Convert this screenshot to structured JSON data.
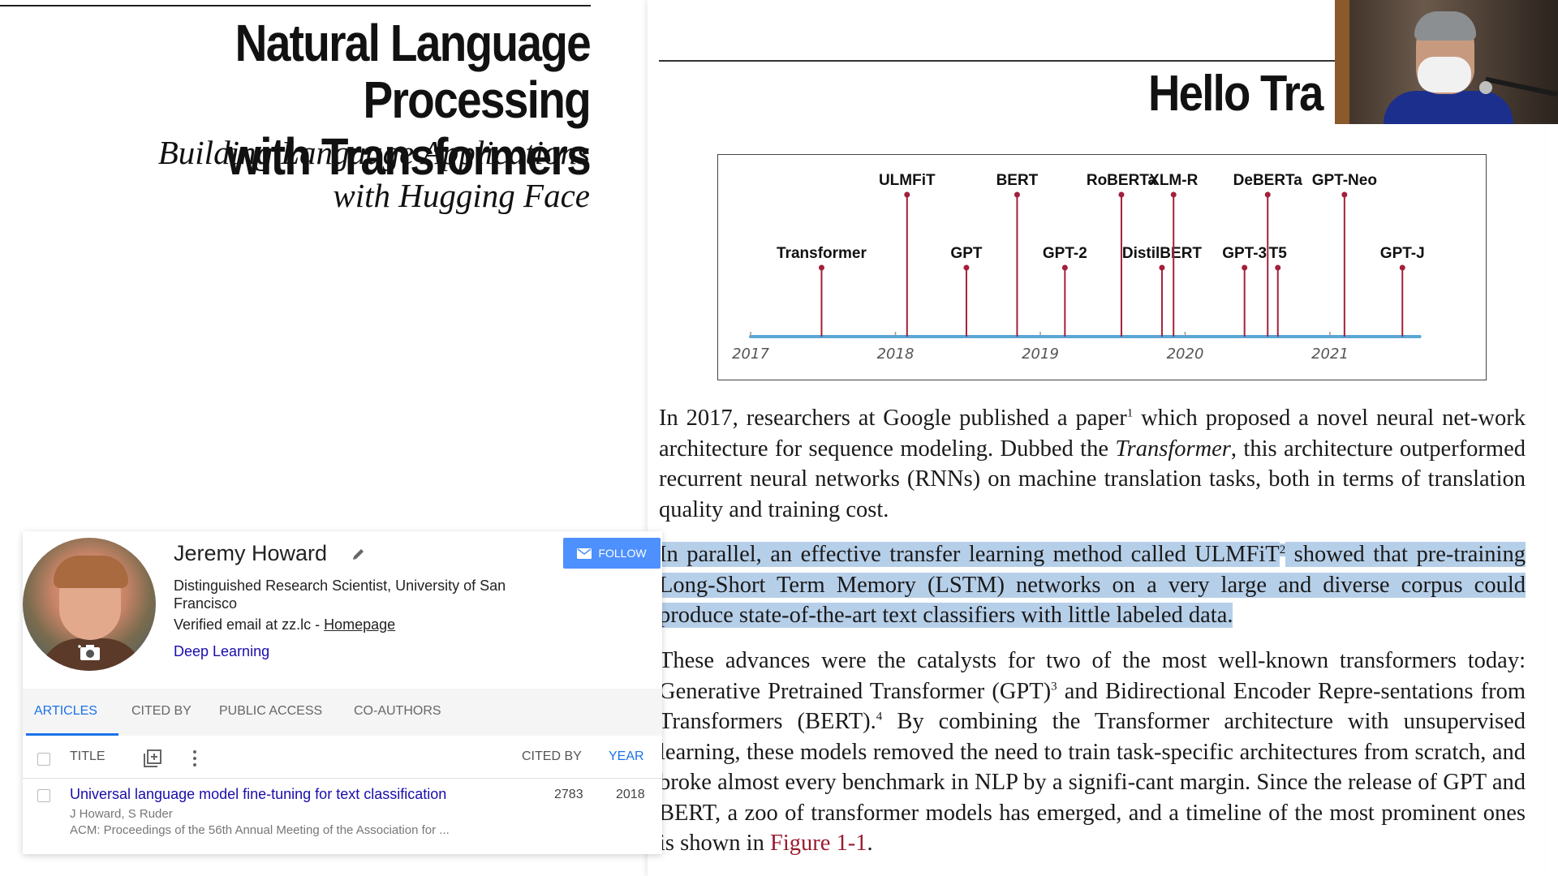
{
  "cover": {
    "title_line1": "Natural Language Processing",
    "title_line2": "with Transformers",
    "subtitle_line1": "Building Language Applications",
    "subtitle_line2": "with Hugging Face"
  },
  "page": {
    "heading": "Hello Tra",
    "paragraph1": {
      "before_sup": "In 2017, researchers at Google published a paper",
      "sup": "1",
      "after_sup": " which proposed a novel neural net-work architecture for sequence modeling. Dubbed the ",
      "italic": "Transformer",
      "end": ", this architecture outperformed recurrent neural networks (RNNs) on machine translation tasks, both in terms of translation quality and training cost."
    },
    "paragraph2": {
      "before_sup": "In parallel, an effective transfer learning method called ULMFiT",
      "sup": "2",
      "after_sup": " showed that pre-training Long-Short Term Memory (LSTM) networks on a very large and diverse corpus could produce state-of-the-art text classifiers with little labeled data."
    },
    "paragraph3": {
      "part1": "These advances were the catalysts for two of the most well-known transformers today: Generative Pretrained Transformer (GPT)",
      "sup1": "3",
      "part2": " and Bidirectional Encoder Repre-sentations from Transformers (BERT).",
      "sup2": "4",
      "part3": " By combining the Transformer architecture with unsupervised learning, these models removed the need to train task-specific architectures from scratch, and broke almost every benchmark in NLP by a signifi-cant margin. Since the release of GPT and BERT, a zoo of transformer models has emerged, and a timeline of the most prominent ones is shown in ",
      "figure_ref": "Figure 1-1",
      "end": "."
    }
  },
  "chart_data": {
    "type": "timeline",
    "x_ticks": [
      "2017",
      "2018",
      "2019",
      "2020",
      "2021"
    ],
    "xlim": [
      2017.0,
      2021.62
    ],
    "colors": {
      "axis": "#5aa6d6",
      "stem": "#a3203c"
    },
    "events": [
      {
        "label": "Transformer",
        "date": 2017.49,
        "level": "low"
      },
      {
        "label": "ULMFiT",
        "date": 2018.08,
        "level": "high"
      },
      {
        "label": "GPT",
        "date": 2018.49,
        "level": "low"
      },
      {
        "label": "BERT",
        "date": 2018.84,
        "level": "high"
      },
      {
        "label": "GPT-2",
        "date": 2019.17,
        "level": "low"
      },
      {
        "label": "RoBERTa",
        "date": 2019.56,
        "level": "high"
      },
      {
        "label": "DistilBERT",
        "date": 2019.84,
        "level": "low"
      },
      {
        "label": "XLM-R",
        "date": 2019.92,
        "level": "high"
      },
      {
        "label": "GPT-3",
        "date": 2020.41,
        "level": "low"
      },
      {
        "label": "DeBERTa",
        "date": 2020.57,
        "level": "high"
      },
      {
        "label": "T5",
        "date": 2020.64,
        "level": "low"
      },
      {
        "label": "GPT-Neo",
        "date": 2021.1,
        "level": "high"
      },
      {
        "label": "GPT-J",
        "date": 2021.5,
        "level": "low"
      }
    ]
  },
  "scholar": {
    "name": "Jeremy Howard",
    "affiliation": "Distinguished Research Scientist, University of San Francisco",
    "email_text": "Verified email at zz.lc - ",
    "homepage_label": "Homepage",
    "interest": "Deep Learning",
    "follow_label": "FOLLOW",
    "tabs": [
      "ARTICLES",
      "CITED BY",
      "PUBLIC ACCESS",
      "CO-AUTHORS"
    ],
    "columns": {
      "title": "TITLE",
      "cited_by": "CITED BY",
      "year": "YEAR"
    },
    "articles": [
      {
        "title": "Universal language model fine-tuning for text classification",
        "authors": "J Howard, S Ruder",
        "venue": "ACM: Proceedings of the 56th Annual Meeting of the Association for ...",
        "cited_by": "2783",
        "year": "2018"
      }
    ]
  }
}
